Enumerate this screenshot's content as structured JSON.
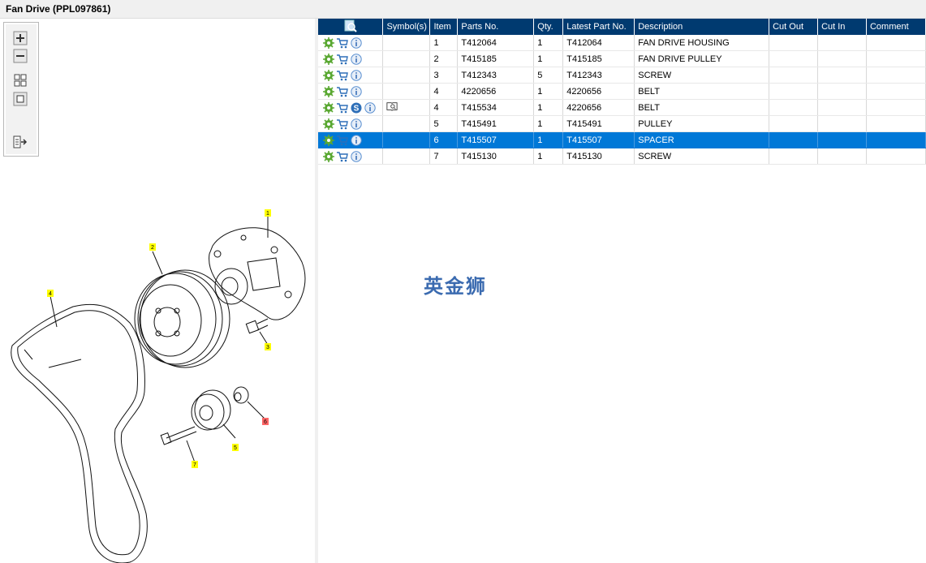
{
  "window": {
    "title": "Fan Drive (PPL097861)"
  },
  "toolbar": {
    "buttons": [
      {
        "name": "zoom-in-button",
        "icon": "zoom-in-icon"
      },
      {
        "name": "zoom-out-button",
        "icon": "zoom-out-icon"
      },
      {
        "name": "fit-all-button",
        "icon": "fit-all-icon"
      },
      {
        "name": "actual-size-button",
        "icon": "actual-size-icon"
      },
      {
        "name": "export-list-button",
        "icon": "export-list-icon"
      }
    ]
  },
  "drawing": {
    "callouts": [
      "1",
      "2",
      "3",
      "4",
      "5",
      "6",
      "7"
    ],
    "highlighted_callout": "6"
  },
  "table": {
    "headers": {
      "actions": "",
      "symbols": "Symbol(s)",
      "item": "Item",
      "parts_no": "Parts No.",
      "qty": "Qty.",
      "latest_part_no": "Latest Part No.",
      "description": "Description",
      "cut_out": "Cut Out",
      "cut_in": "Cut In",
      "comment": "Comment"
    },
    "rows": [
      {
        "item": "1",
        "parts_no": "T412064",
        "qty": "1",
        "latest_part_no": "T412064",
        "description": "FAN DRIVE HOUSING",
        "cut_out": "",
        "cut_in": "",
        "comment": "",
        "has_s": false,
        "has_symbol": false,
        "selected": false
      },
      {
        "item": "2",
        "parts_no": "T415185",
        "qty": "1",
        "latest_part_no": "T415185",
        "description": "FAN DRIVE PULLEY",
        "cut_out": "",
        "cut_in": "",
        "comment": "",
        "has_s": false,
        "has_symbol": false,
        "selected": false
      },
      {
        "item": "3",
        "parts_no": "T412343",
        "qty": "5",
        "latest_part_no": "T412343",
        "description": "SCREW",
        "cut_out": "",
        "cut_in": "",
        "comment": "",
        "has_s": false,
        "has_symbol": false,
        "selected": false
      },
      {
        "item": "4",
        "parts_no": "4220656",
        "qty": "1",
        "latest_part_no": "4220656",
        "description": "BELT",
        "cut_out": "",
        "cut_in": "",
        "comment": "",
        "has_s": false,
        "has_symbol": false,
        "selected": false
      },
      {
        "item": "4",
        "parts_no": "T415534",
        "qty": "1",
        "latest_part_no": "4220656",
        "description": "BELT",
        "cut_out": "",
        "cut_in": "",
        "comment": "",
        "has_s": true,
        "has_symbol": true,
        "selected": false
      },
      {
        "item": "5",
        "parts_no": "T415491",
        "qty": "1",
        "latest_part_no": "T415491",
        "description": "PULLEY",
        "cut_out": "",
        "cut_in": "",
        "comment": "",
        "has_s": false,
        "has_symbol": false,
        "selected": false
      },
      {
        "item": "6",
        "parts_no": "T415507",
        "qty": "1",
        "latest_part_no": "T415507",
        "description": "SPACER",
        "cut_out": "",
        "cut_in": "",
        "comment": "",
        "has_s": false,
        "has_symbol": false,
        "selected": true
      },
      {
        "item": "7",
        "parts_no": "T415130",
        "qty": "1",
        "latest_part_no": "T415130",
        "description": "SCREW",
        "cut_out": "",
        "cut_in": "",
        "comment": "",
        "has_s": false,
        "has_symbol": false,
        "selected": false
      }
    ],
    "row_icons": [
      "gear-icon",
      "cart-icon",
      "info-icon"
    ],
    "s_badge": "S"
  },
  "watermark": "英金狮",
  "colors": {
    "header_bg": "#003a70",
    "selected_bg": "#0078d7",
    "gear": "#5aa832",
    "cart": "#2e6fb8",
    "info": "#5a8fd0",
    "callout_yellow": "#ffff00",
    "callout_red": "#ff6666"
  }
}
